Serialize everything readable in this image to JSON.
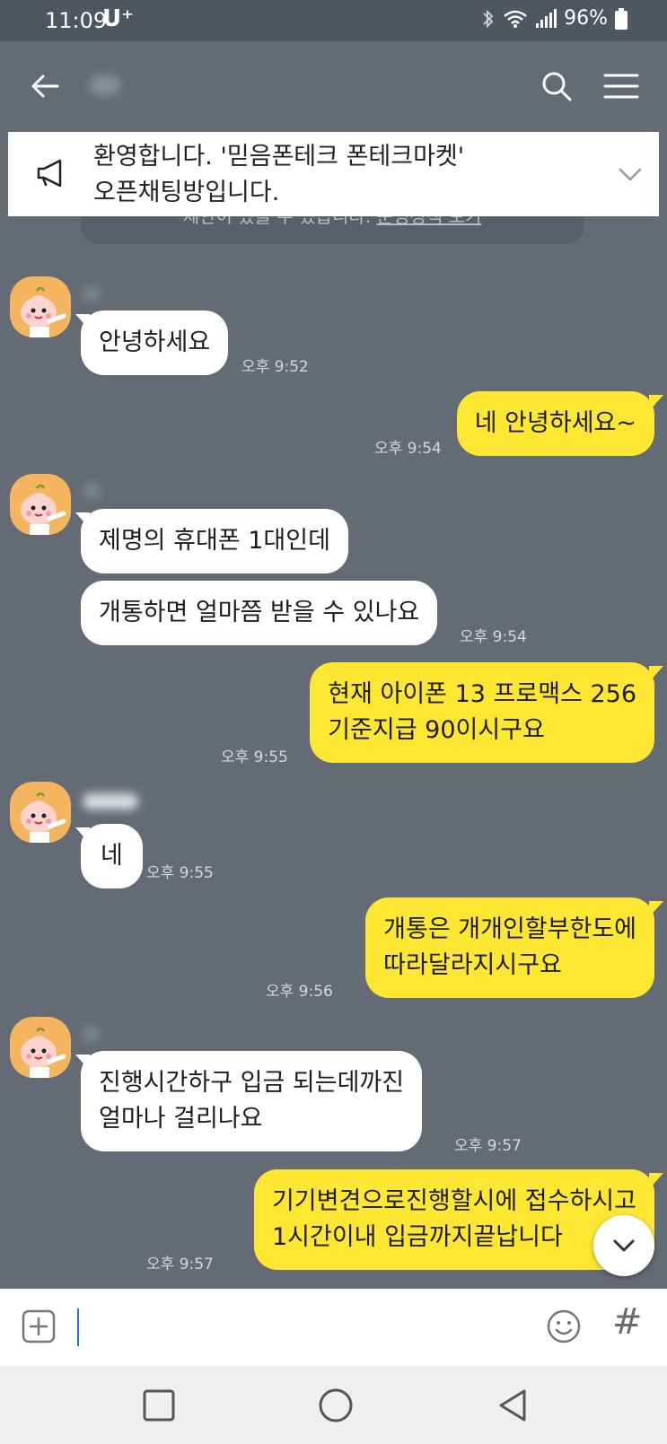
{
  "status_bar": {
    "time": "11:09",
    "carrier": "U⁺",
    "battery": "96%"
  },
  "header": {
    "icons": {
      "back": "back-arrow-icon",
      "search": "search-icon",
      "menu": "hamburger-menu-icon"
    }
  },
  "notice": {
    "text": "환영합니다. '믿음폰테크 폰테크마켓'\n오픈채팅방입니다.",
    "sub_text": "제안이 있을 수 있습니다.",
    "sub_link": "운영정책 보기",
    "icon": "megaphone-icon"
  },
  "messages": [
    {
      "side": "in",
      "text": "안녕하세요",
      "time": "오후 9:52"
    },
    {
      "side": "out",
      "text": "네 안녕하세요~",
      "time": "오후 9:54"
    },
    {
      "side": "in",
      "text": "제명의 휴대폰 1대인데"
    },
    {
      "side": "in",
      "text": "개통하면 얼마쯤 받을 수 있나요",
      "time": "오후 9:54"
    },
    {
      "side": "out",
      "text": "현재 아이폰 13 프로맥스 256\n기준지급 90이시구요",
      "time": "오후 9:55"
    },
    {
      "side": "in",
      "text": "네",
      "time": "오후 9:55"
    },
    {
      "side": "out",
      "text": "개통은 개개인할부한도에\n따라달라지시구요",
      "time": "오후 9:56"
    },
    {
      "side": "in",
      "text": "진행시간하구 입금 되는데까진\n얼마나 걸리나요",
      "time": "오후 9:57"
    },
    {
      "side": "out",
      "text": "기기변견으로진행할시에 접수하시고\n1시간이내 입금까지끝납니다",
      "time": "오후 9:57"
    }
  ],
  "input": {
    "placeholder": "",
    "icons": {
      "plus": "plus-icon",
      "emoji": "emoji-icon",
      "hash": "#"
    }
  },
  "colors": {
    "chat_bg": "#656b75",
    "out_bubble": "#fde733",
    "in_bubble": "#ffffff",
    "avatar": "#f4b55e"
  }
}
